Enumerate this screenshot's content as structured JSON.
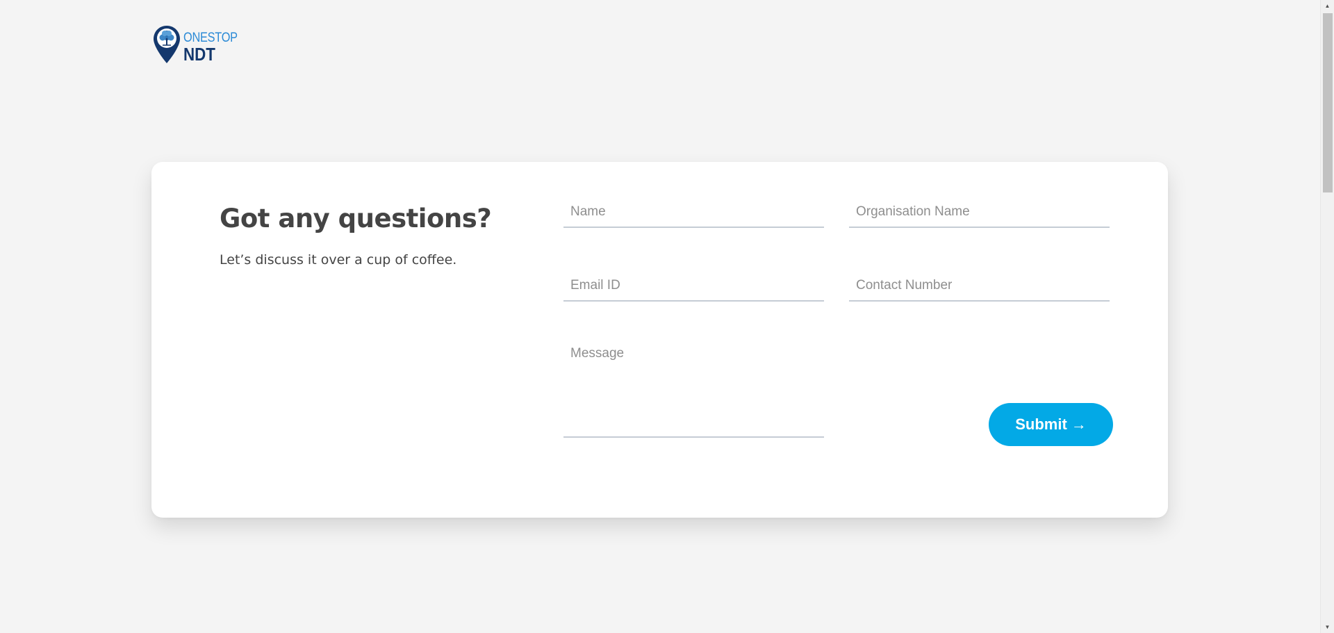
{
  "logo": {
    "line1": "ONESTOP",
    "line2": "NDT",
    "colors": {
      "pin": "#14386d",
      "line1": "#2b8ad6",
      "line2": "#14386d"
    }
  },
  "contact": {
    "heading": "Got any questions?",
    "subtext": "Let’s discuss it over a cup of coffee.",
    "fields": {
      "name": {
        "placeholder": "Name",
        "value": ""
      },
      "organisation": {
        "placeholder": "Organisation Name",
        "value": ""
      },
      "email": {
        "placeholder": "Email ID",
        "value": ""
      },
      "contact_number": {
        "placeholder": "Contact Number",
        "value": ""
      },
      "message": {
        "placeholder": "Message",
        "value": ""
      }
    },
    "submit_label": "Submit",
    "submit_arrow": "→",
    "colors": {
      "accent": "#03a9e6",
      "text": "#444444",
      "underline": "#c5ccd5"
    }
  },
  "scrollbar": {
    "up_icon": "▲",
    "down_icon": "▼"
  }
}
